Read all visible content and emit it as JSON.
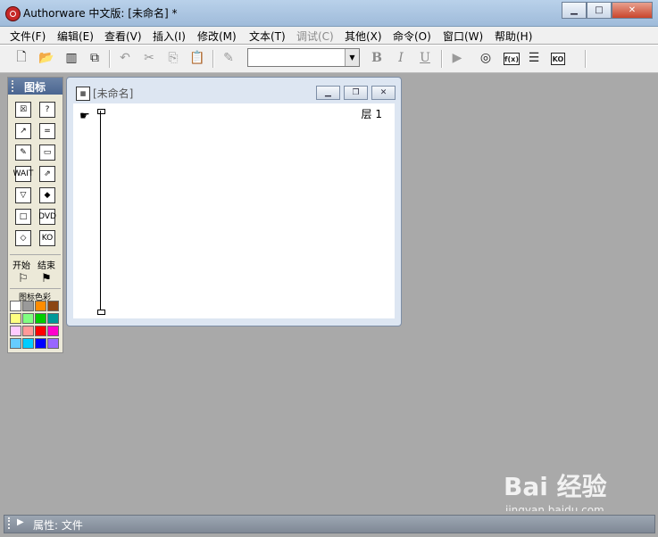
{
  "window": {
    "title": "Authorware 中文版: [未命名] *",
    "buttons": {
      "minimize": "▁",
      "maximize": "□",
      "close": "✕"
    }
  },
  "menu": [
    {
      "label": "文件(F)",
      "enabled": true
    },
    {
      "label": "编辑(E)",
      "enabled": true
    },
    {
      "label": "查看(V)",
      "enabled": true
    },
    {
      "label": "插入(I)",
      "enabled": true
    },
    {
      "label": "修改(M)",
      "enabled": true
    },
    {
      "label": "文本(T)",
      "enabled": true
    },
    {
      "label": "调试(C)",
      "enabled": false
    },
    {
      "label": "其他(X)",
      "enabled": true
    },
    {
      "label": "命令(O)",
      "enabled": true
    },
    {
      "label": "窗口(W)",
      "enabled": true
    },
    {
      "label": "帮助(H)",
      "enabled": true
    }
  ],
  "toolbar": {
    "new": "🗋",
    "open": "📂",
    "save_all": "▥",
    "import": "⧉",
    "undo": "↶",
    "cut": "✂",
    "copy": "⎘",
    "paste": "📋",
    "find": "✎",
    "style_combo_value": "",
    "bold": "B",
    "italic": "I",
    "underline": "U",
    "run": "▶",
    "control_panel": "◎",
    "functions_label": "f(x)",
    "variables": "☰",
    "ko_label": "KO"
  },
  "palette": {
    "title": "图标",
    "icons": [
      {
        "name": "display-icon",
        "glyph": "☒"
      },
      {
        "name": "decision-icon",
        "glyph": "?"
      },
      {
        "name": "motion-icon",
        "glyph": "↗"
      },
      {
        "name": "erase-icon",
        "glyph": "="
      },
      {
        "name": "wait-icon",
        "glyph": "✎"
      },
      {
        "name": "navigate-icon",
        "glyph": "▭"
      },
      {
        "name": "framework-icon",
        "glyph": "WAIT"
      },
      {
        "name": "calculation-icon",
        "glyph": "⇗"
      },
      {
        "name": "map-icon",
        "glyph": "▽"
      },
      {
        "name": "digital-movie-icon",
        "glyph": "◆"
      },
      {
        "name": "sound-icon",
        "glyph": "□"
      },
      {
        "name": "dvd-icon",
        "glyph": "DVD"
      },
      {
        "name": "interaction-icon",
        "glyph": "◇"
      },
      {
        "name": "knowledge-object-icon",
        "glyph": "KO"
      }
    ],
    "start_label": "开始",
    "end_label": "结束",
    "colors_label": "图标色彩",
    "colors": [
      "#ffffff",
      "#9a9a9a",
      "#ff8c00",
      "#8b4513",
      "#ffff80",
      "#80ff80",
      "#00cc00",
      "#009999",
      "#ffccff",
      "#ff9999",
      "#ff0000",
      "#ff00cc",
      "#66ccff",
      "#00ccff",
      "#0000ff",
      "#9966ff"
    ]
  },
  "design_window": {
    "title": "[未命名]",
    "layer_label": "层 1",
    "buttons": {
      "minimize": "▁",
      "restore": "❐",
      "close": "✕"
    }
  },
  "status": {
    "label": "属性: 文件"
  },
  "watermark": {
    "main": "Bai 经验",
    "sub": "jingyan.baidu.com"
  }
}
